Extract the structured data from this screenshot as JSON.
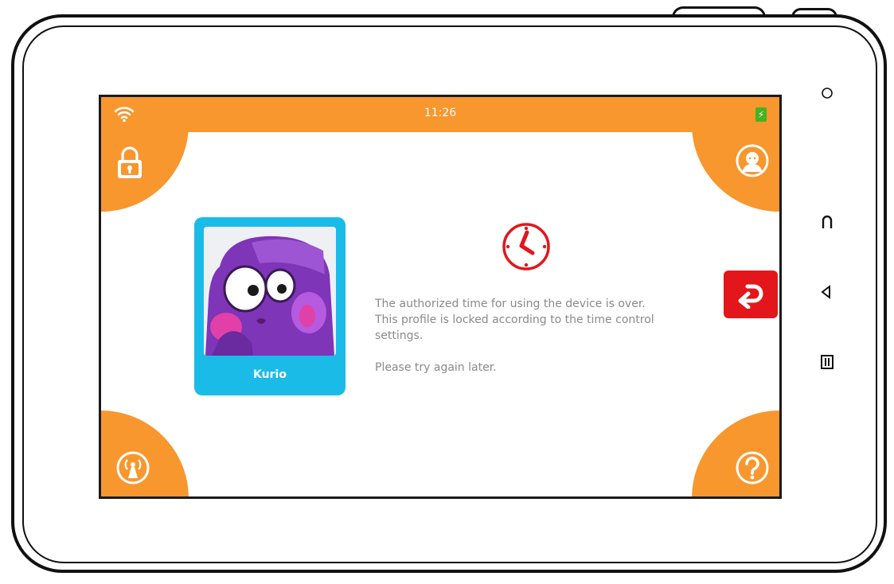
{
  "status_bar": {
    "time": "11:26",
    "wifi_icon": "wifi-icon",
    "battery_icon": "battery-charging-icon",
    "background_color": "#f7972e",
    "battery_color": "#46b21f"
  },
  "corners": {
    "top_left_icon": "lock-icon",
    "top_right_icon": "profile-icon",
    "bottom_left_icon": "wireless-icon",
    "bottom_right_icon": "help-icon",
    "color": "#f7972e"
  },
  "profile": {
    "name": "Kurio",
    "avatar_icon": "purple-monster-avatar",
    "card_color": "#1bbbe8"
  },
  "message": {
    "line1": "The authorized time for using the device is over.",
    "line2": "This profile is locked according to the time control",
    "line3": "settings.",
    "line4": "Please try again later."
  },
  "clock_icon": "clock-icon",
  "back_button": {
    "icon": "back-arrow-icon",
    "color": "#e3161b"
  },
  "hardware_keys": [
    "power-icon",
    "home-icon",
    "back-icon",
    "menu-icon"
  ]
}
